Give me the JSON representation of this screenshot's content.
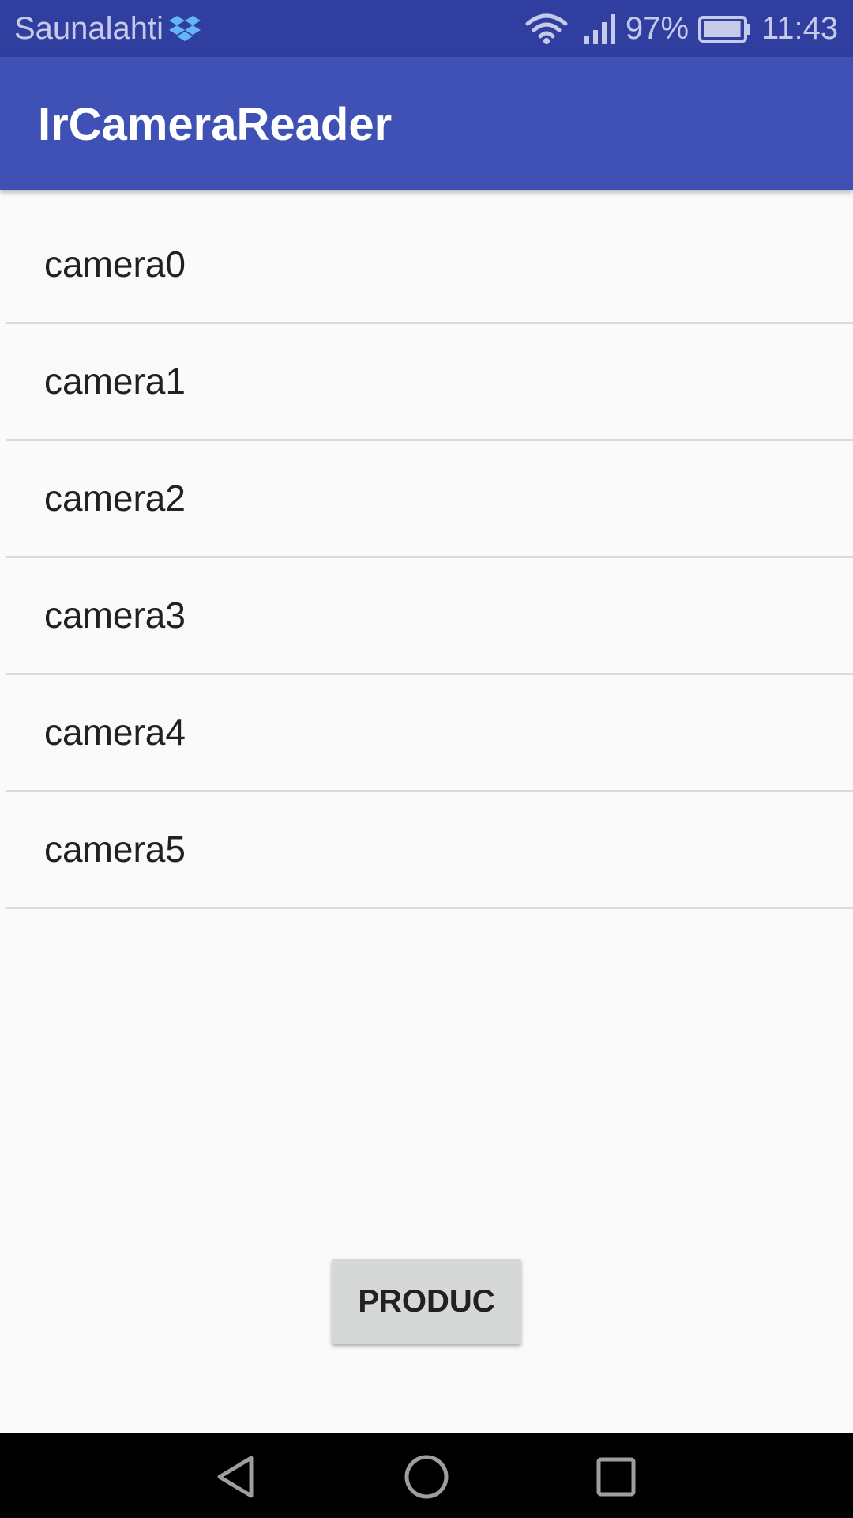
{
  "status_bar": {
    "carrier": "Saunalahti",
    "battery_percent": "97%",
    "battery_level": 0.97,
    "time": "11:43",
    "icons": [
      "dropbox-icon",
      "wifi-icon",
      "signal-icon",
      "battery-icon"
    ],
    "background_color": "#303f9f"
  },
  "app_bar": {
    "title": "IrCameraReader",
    "background_color": "#3f51b5"
  },
  "camera_list": {
    "items": [
      {
        "label": "camera0"
      },
      {
        "label": "camera1"
      },
      {
        "label": "camera2"
      },
      {
        "label": "camera3"
      },
      {
        "label": "camera4"
      },
      {
        "label": "camera5"
      }
    ]
  },
  "produc_button": {
    "label": "PRODUC"
  },
  "nav_bar": {
    "icons": [
      "back-icon",
      "home-icon",
      "recents-icon"
    ]
  }
}
